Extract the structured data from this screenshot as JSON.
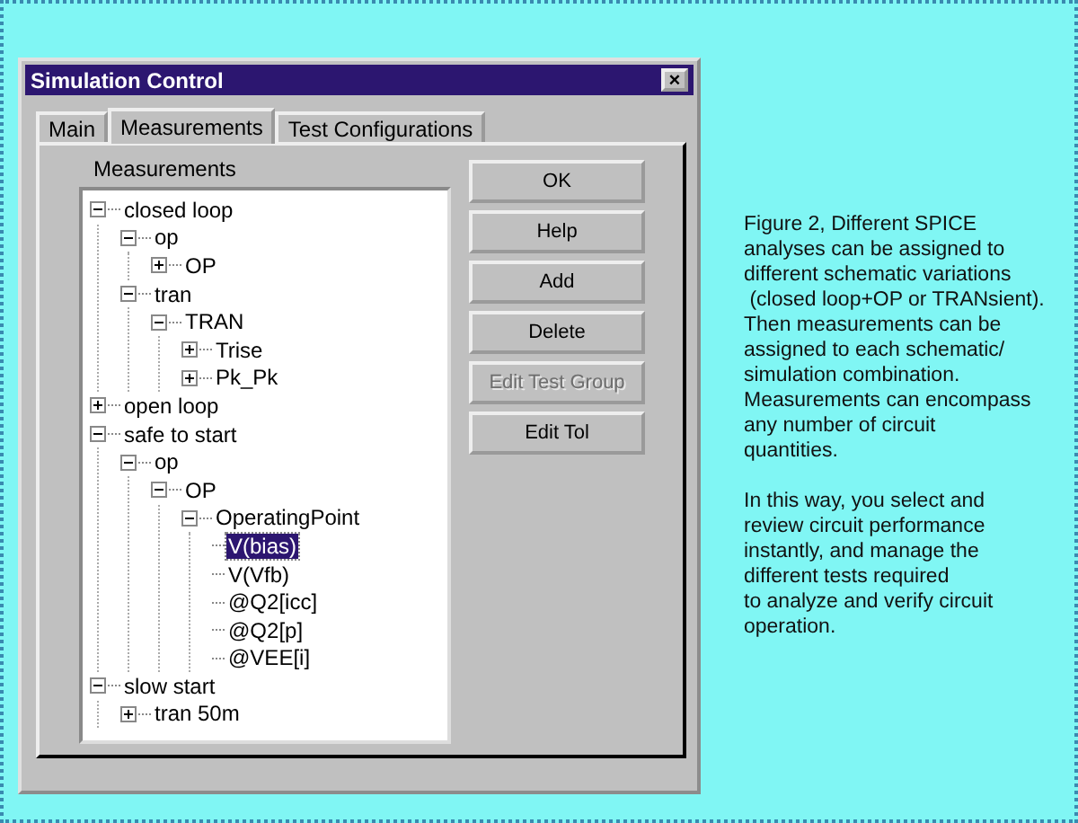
{
  "window": {
    "title": "Simulation Control",
    "close": "×"
  },
  "tabs": [
    {
      "label": "Main",
      "selected": false
    },
    {
      "label": "Measurements",
      "selected": true
    },
    {
      "label": "Test Configurations",
      "selected": false
    }
  ],
  "tree_label": "Measurements",
  "tree": [
    {
      "label": "closed loop",
      "expanded": true,
      "selected": false,
      "children": [
        {
          "label": "op",
          "expanded": true,
          "selected": false,
          "children": [
            {
              "label": "OP",
              "expanded": false,
              "selected": false
            }
          ]
        },
        {
          "label": "tran",
          "expanded": true,
          "selected": false,
          "children": [
            {
              "label": "TRAN",
              "expanded": true,
              "selected": false,
              "children": [
                {
                  "label": "Trise",
                  "expanded": false,
                  "selected": false
                },
                {
                  "label": "Pk_Pk",
                  "expanded": false,
                  "selected": false
                }
              ]
            }
          ]
        }
      ]
    },
    {
      "label": "open loop",
      "expanded": false,
      "selected": false
    },
    {
      "label": "safe to start",
      "expanded": true,
      "selected": false,
      "children": [
        {
          "label": "op",
          "expanded": true,
          "selected": false,
          "children": [
            {
              "label": "OP",
              "expanded": true,
              "selected": false,
              "children": [
                {
                  "label": "OperatingPoint",
                  "expanded": true,
                  "selected": false,
                  "children": [
                    {
                      "label": "V(bias)",
                      "selected": true
                    },
                    {
                      "label": "V(Vfb)",
                      "selected": false
                    },
                    {
                      "label": "@Q2[icc]",
                      "selected": false
                    },
                    {
                      "label": "@Q2[p]",
                      "selected": false
                    },
                    {
                      "label": "@VEE[i]",
                      "selected": false
                    }
                  ]
                }
              ]
            }
          ]
        }
      ]
    },
    {
      "label": "slow start",
      "expanded": true,
      "selected": false,
      "children": [
        {
          "label": "tran 50m",
          "expanded": false,
          "selected": false
        }
      ]
    }
  ],
  "buttons": [
    {
      "label": "OK",
      "disabled": false
    },
    {
      "label": "Help",
      "disabled": false
    },
    {
      "label": "Add",
      "disabled": false
    },
    {
      "label": "Delete",
      "disabled": false
    },
    {
      "label": "Edit Test Group",
      "disabled": true
    },
    {
      "label": "Edit Tol",
      "disabled": false
    }
  ],
  "caption": [
    "Figure 2, Different SPICE\nanalyses can be assigned to\ndifferent schematic variations\n (closed loop+OP or TRANsient).\nThen measurements can be\nassigned to each schematic/\nsimulation combination.\nMeasurements can encompass\nany number of circuit\nquantities.",
    "In this way, you select and\nreview circuit performance\ninstantly, and manage the\ndifferent tests required\nto analyze and verify circuit\noperation."
  ]
}
